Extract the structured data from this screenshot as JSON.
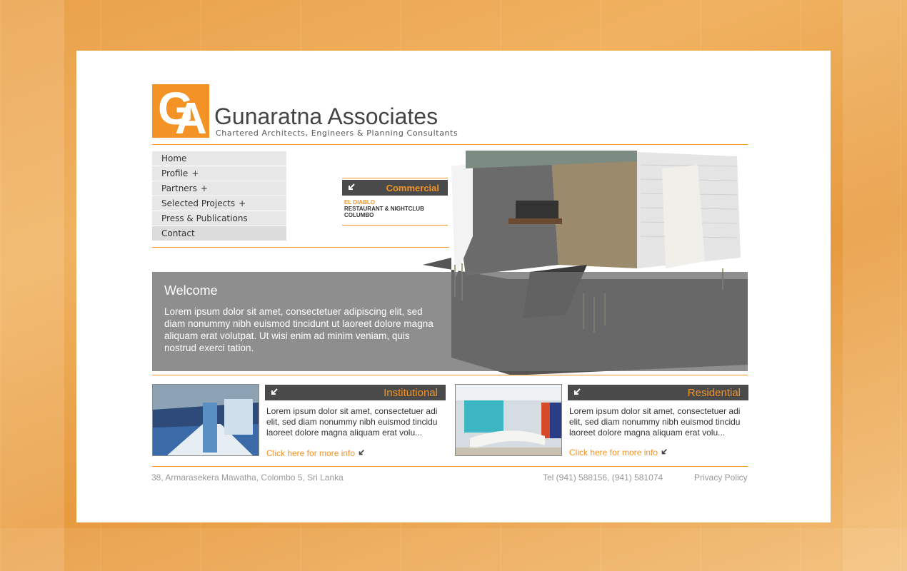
{
  "brand": {
    "logo_letters": "GA",
    "name": "Gunaratna Associates",
    "tagline": "Chartered Architects, Engineers & Planning Consultants"
  },
  "nav": {
    "items": [
      {
        "label": "Home",
        "plus": ""
      },
      {
        "label": "Profile",
        "plus": "+"
      },
      {
        "label": "Partners",
        "plus": "+"
      },
      {
        "label": "Selected Projects",
        "plus": "+"
      },
      {
        "label": "Press & Publications",
        "plus": ""
      },
      {
        "label": "Contact",
        "plus": ""
      }
    ]
  },
  "featured": {
    "category": "Commercial",
    "title": "EL DIABLO",
    "line2": "RESTAURANT & NIGHTCLUB",
    "line3": "COLUMBO"
  },
  "welcome": {
    "title": "Welcome",
    "text": "Lorem ipsum dolor sit amet, consectetuer adipiscing elit, sed diam nonummy nibh euismod tincidunt ut laoreet dolore magna aliquam erat volutpat. Ut wisi enim ad minim veniam, quis nostrud exerci tation."
  },
  "cards": [
    {
      "category": "Institutional",
      "text": "Lorem ipsum dolor sit amet, consectetuer adi elit, sed diam nonummy nibh euismod tincidu laoreet dolore magna aliquam erat volu...",
      "link": "Click here for more info"
    },
    {
      "category": "Residential",
      "text": "Lorem ipsum dolor sit amet, consectetuer adi elit, sed diam nonummy nibh euismod tincidu laoreet dolore magna aliquam erat volu...",
      "link": "Click here for more info"
    }
  ],
  "footer": {
    "address": "38, Armarasekera Mawatha, Colombo 5, Sri Lanka",
    "phone": "Tel (941) 588156, (941) 581074",
    "privacy": "Privacy Policy"
  },
  "colors": {
    "accent": "#f39325",
    "dark_bar": "#4a4a4a",
    "background": "#e9a04a"
  }
}
